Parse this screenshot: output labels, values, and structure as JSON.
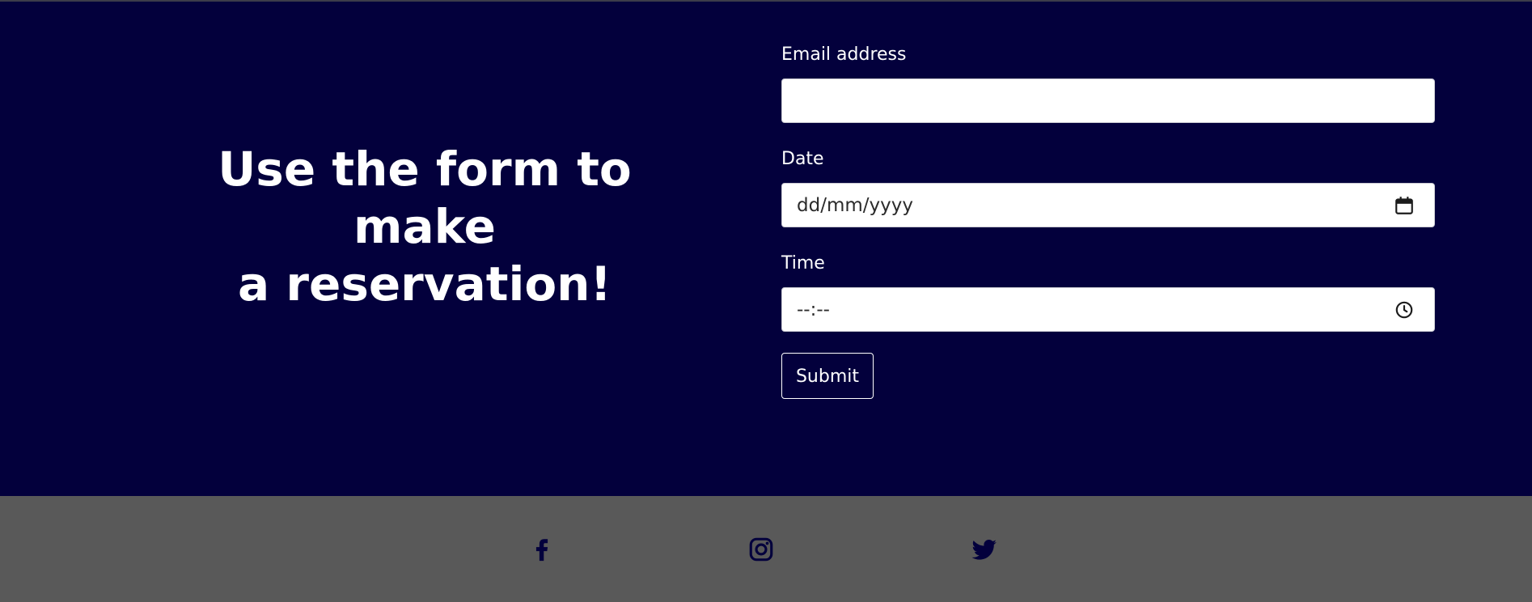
{
  "headline": {
    "line1": "Use the form to make",
    "line2": "a reservation!"
  },
  "form": {
    "email": {
      "label": "Email address",
      "value": ""
    },
    "date": {
      "label": "Date",
      "placeholder": "dd/mm/yyyy",
      "icon": "calendar-icon"
    },
    "time": {
      "label": "Time",
      "placeholder": "--:--",
      "icon": "clock-icon"
    },
    "submit_label": "Submit"
  },
  "footer": {
    "icons": [
      "facebook-icon",
      "instagram-icon",
      "twitter-icon"
    ]
  },
  "colors": {
    "hero_background": "#03003c",
    "footer_background": "#595959",
    "icon_color": "#03003c",
    "text_light": "#ffffff"
  }
}
